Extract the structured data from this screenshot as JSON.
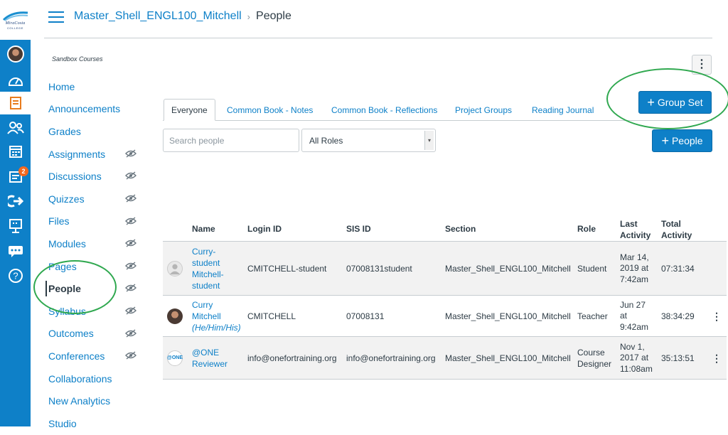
{
  "logo": {
    "line1": "MiraCosta",
    "line2": "COLLEGE"
  },
  "global_nav": {
    "inbox_badge": "2"
  },
  "breadcrumb": {
    "course": "Master_Shell_ENGL100_Mitchell",
    "current": "People"
  },
  "course_nav": {
    "term": "Sandbox Courses",
    "items": [
      {
        "label": "Home",
        "hidden": false
      },
      {
        "label": "Announcements",
        "hidden": false
      },
      {
        "label": "Grades",
        "hidden": false
      },
      {
        "label": "Assignments",
        "hidden": true
      },
      {
        "label": "Discussions",
        "hidden": true
      },
      {
        "label": "Quizzes",
        "hidden": true
      },
      {
        "label": "Files",
        "hidden": true
      },
      {
        "label": "Modules",
        "hidden": true
      },
      {
        "label": "Pages",
        "hidden": true
      },
      {
        "label": "People",
        "hidden": true,
        "active": true
      },
      {
        "label": "Syllabus",
        "hidden": true
      },
      {
        "label": "Outcomes",
        "hidden": true
      },
      {
        "label": "Conferences",
        "hidden": true
      },
      {
        "label": "Collaborations",
        "hidden": false
      },
      {
        "label": "New Analytics",
        "hidden": false
      },
      {
        "label": "Studio",
        "hidden": false
      }
    ]
  },
  "tabs": [
    "Everyone",
    "Common Book - Notes",
    "Common Book - Reflections",
    "Project Groups",
    "Reading Journal"
  ],
  "buttons": {
    "group_set": "Group Set",
    "people": "People",
    "plus": "+"
  },
  "search": {
    "placeholder": "Search people"
  },
  "roles_select": {
    "selected": "All Roles"
  },
  "table": {
    "headers": {
      "name": "Name",
      "login": "Login ID",
      "sis": "SIS ID",
      "section": "Section",
      "role": "Role",
      "last1": "Last",
      "last2": "Activity",
      "total1": "Total",
      "total2": "Activity"
    },
    "rows": [
      {
        "name_lines": [
          "Curry-",
          "student",
          "Mitchell-",
          "student"
        ],
        "pronouns": "",
        "login": "CMITCHELL-student",
        "sis": "07008131student",
        "section": "Master_Shell_ENGL100_Mitchell",
        "role_lines": [
          "Student"
        ],
        "last_lines": [
          "Mar 14,",
          "2019 at",
          "7:42am"
        ],
        "total": "07:31:34"
      },
      {
        "name_lines": [
          "Curry",
          "Mitchell"
        ],
        "pronouns": "(He/Him/His)",
        "login": "CMITCHELL",
        "sis": "07008131",
        "section": "Master_Shell_ENGL100_Mitchell",
        "role_lines": [
          "Teacher"
        ],
        "last_lines": [
          "Jun 27",
          "at",
          "9:42am"
        ],
        "total": "38:34:29"
      },
      {
        "name_lines": [
          "@ONE",
          "Reviewer"
        ],
        "pronouns": "",
        "login": "info@onefortraining.org",
        "sis": "info@onefortraining.org",
        "section": "Master_Shell_ENGL100_Mitchell",
        "role_lines": [
          "Course",
          "Designer"
        ],
        "last_lines": [
          "Nov 1,",
          "2017 at",
          "11:08am"
        ],
        "total": "35:13:51"
      }
    ]
  },
  "avatar_one_text": "@ONE",
  "colors": {
    "brand": "#0e80c8",
    "annotation": "#2fa84f",
    "badge": "#f2681f"
  }
}
